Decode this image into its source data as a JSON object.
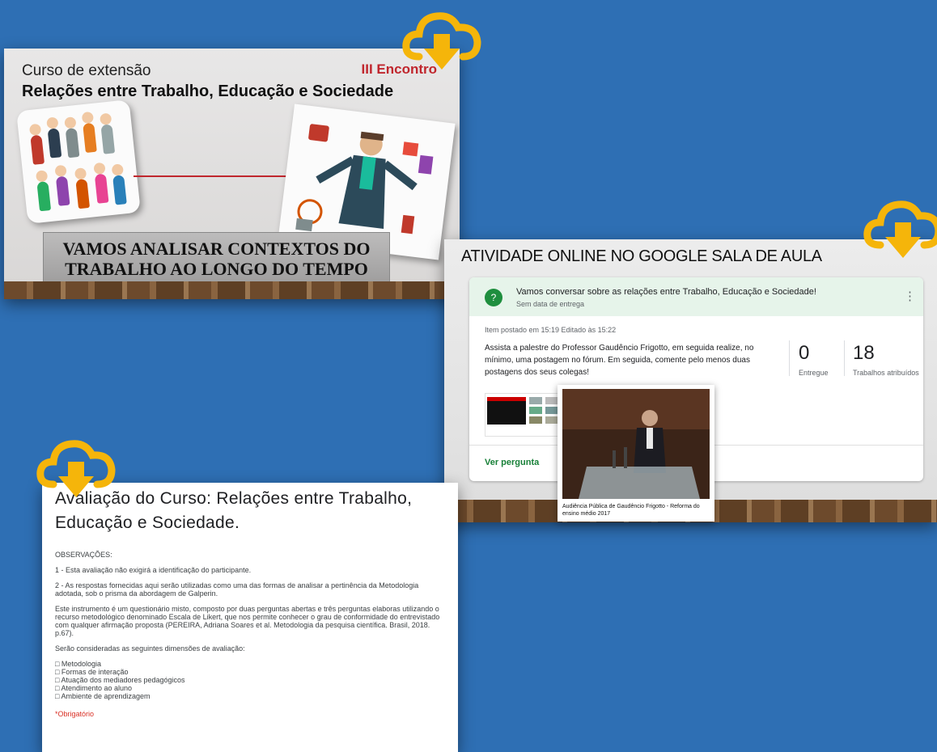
{
  "slide": {
    "course_label": "Curso de extensão",
    "title": "Relações entre Trabalho, Educação e Sociedade",
    "encounter": "III Encontro",
    "banner": "VAMOS ANALISAR CONTEXTOS DO\nTRABALHO AO LONGO DO TEMPO"
  },
  "classroom": {
    "heading": "ATIVIDADE ONLINE NO GOOGLE SALA DE AULA",
    "assignment_title": "Vamos conversar sobre as relações entre Trabalho, Educação e Sociedade!",
    "due": "Sem data de entrega",
    "posted": "Item postado em 15:19 Editado às 15:22",
    "instructions": "Assista a palestre do Professor Gaudêncio Frigotto, em seguida realize, no mínimo, uma postagem no fórum. Em seguida, comente pelo menos duas postagens dos seus colegas!",
    "turned_in_count": "0",
    "turned_in_label": "Entregue",
    "assigned_count": "18",
    "assigned_label": "Trabalhos atribuídos",
    "view_question": "Ver pergunta",
    "video_caption": "Audiência Pública de Gaudêncio Frigotto - Reforma do ensino médio 2017"
  },
  "form": {
    "title": "Avaliação do Curso: Relações entre Trabalho, Educação e Sociedade.",
    "observations_label": "OBSERVAÇÕES:",
    "note1": "1 - Esta avaliação não exigirá a identificação do participante.",
    "note2": "2 - As respostas fornecidas aqui serão utilizadas como uma das formas de analisar a pertinência da Metodologia adotada, sob o prisma da abordagem de Galperin.",
    "note3": "Este instrumento é um questionário misto, composto por duas perguntas abertas e três perguntas elaboras utilizando o recurso metodológico denominado Escala de Likert, que nos permite conhecer o grau de conformidade do entrevistado com qualquer afirmação proposta (PEREIRA, Adriana Soares et al. Metodologia da pesquisa científica. Brasil, 2018. p.67).",
    "dimensions_intro": "Serão consideradas as seguintes dimensões de avaliação:",
    "dimensions": [
      "□ Metodologia",
      "□ Formas de interação",
      "□ Atuação dos mediadores pedagógicos",
      "□ Atendimento ao aluno",
      "□ Ambiente de aprendizagem"
    ],
    "required": "*Obrigatório"
  },
  "icons": [
    "download-cloud-icon",
    "assignment-icon",
    "more-vert-icon"
  ],
  "colors": {
    "background": "#2e6fb4",
    "cloud": "#f5b50a",
    "classroom_green": "#1e8e3e",
    "accent_red": "#c0262d"
  }
}
